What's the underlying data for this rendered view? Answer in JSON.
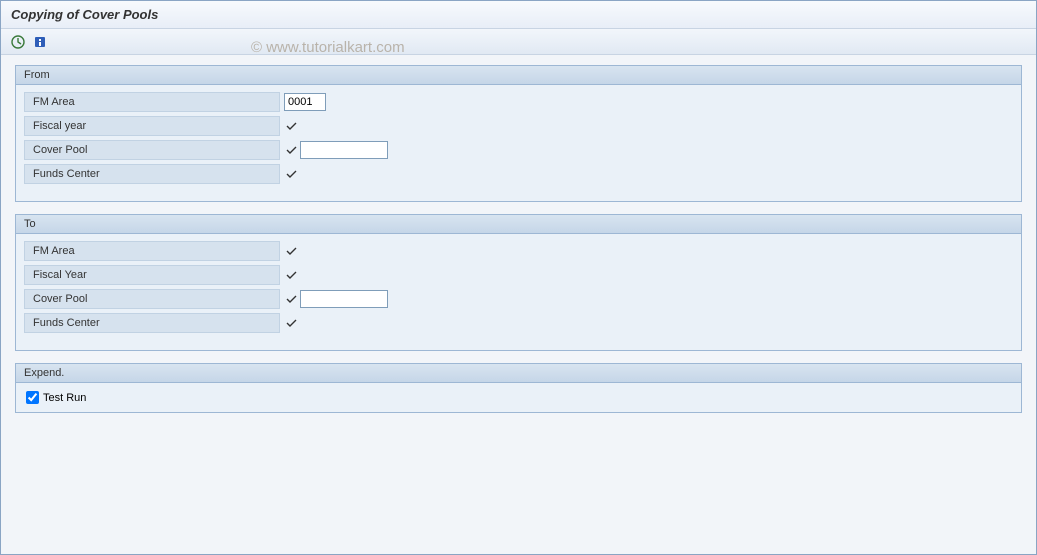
{
  "title": "Copying of Cover Pools",
  "watermark": "© www.tutorialkart.com",
  "toolbar": {
    "execute": "execute",
    "info": "info"
  },
  "groups": {
    "from": {
      "header": "From",
      "fields": {
        "fmArea": {
          "label": "FM Area",
          "value": "0001"
        },
        "fiscalYear": {
          "label": "Fiscal year",
          "value": ""
        },
        "coverPool": {
          "label": "Cover Pool",
          "value": ""
        },
        "fundsCenter": {
          "label": "Funds Center",
          "value": ""
        }
      }
    },
    "to": {
      "header": "To",
      "fields": {
        "fmArea": {
          "label": "FM Area",
          "value": ""
        },
        "fiscalYear": {
          "label": "Fiscal Year",
          "value": ""
        },
        "coverPool": {
          "label": "Cover Pool",
          "value": ""
        },
        "fundsCenter": {
          "label": "Funds Center",
          "value": ""
        }
      }
    },
    "expend": {
      "header": "Expend.",
      "testRun": {
        "label": "Test Run",
        "checked": true
      }
    }
  }
}
